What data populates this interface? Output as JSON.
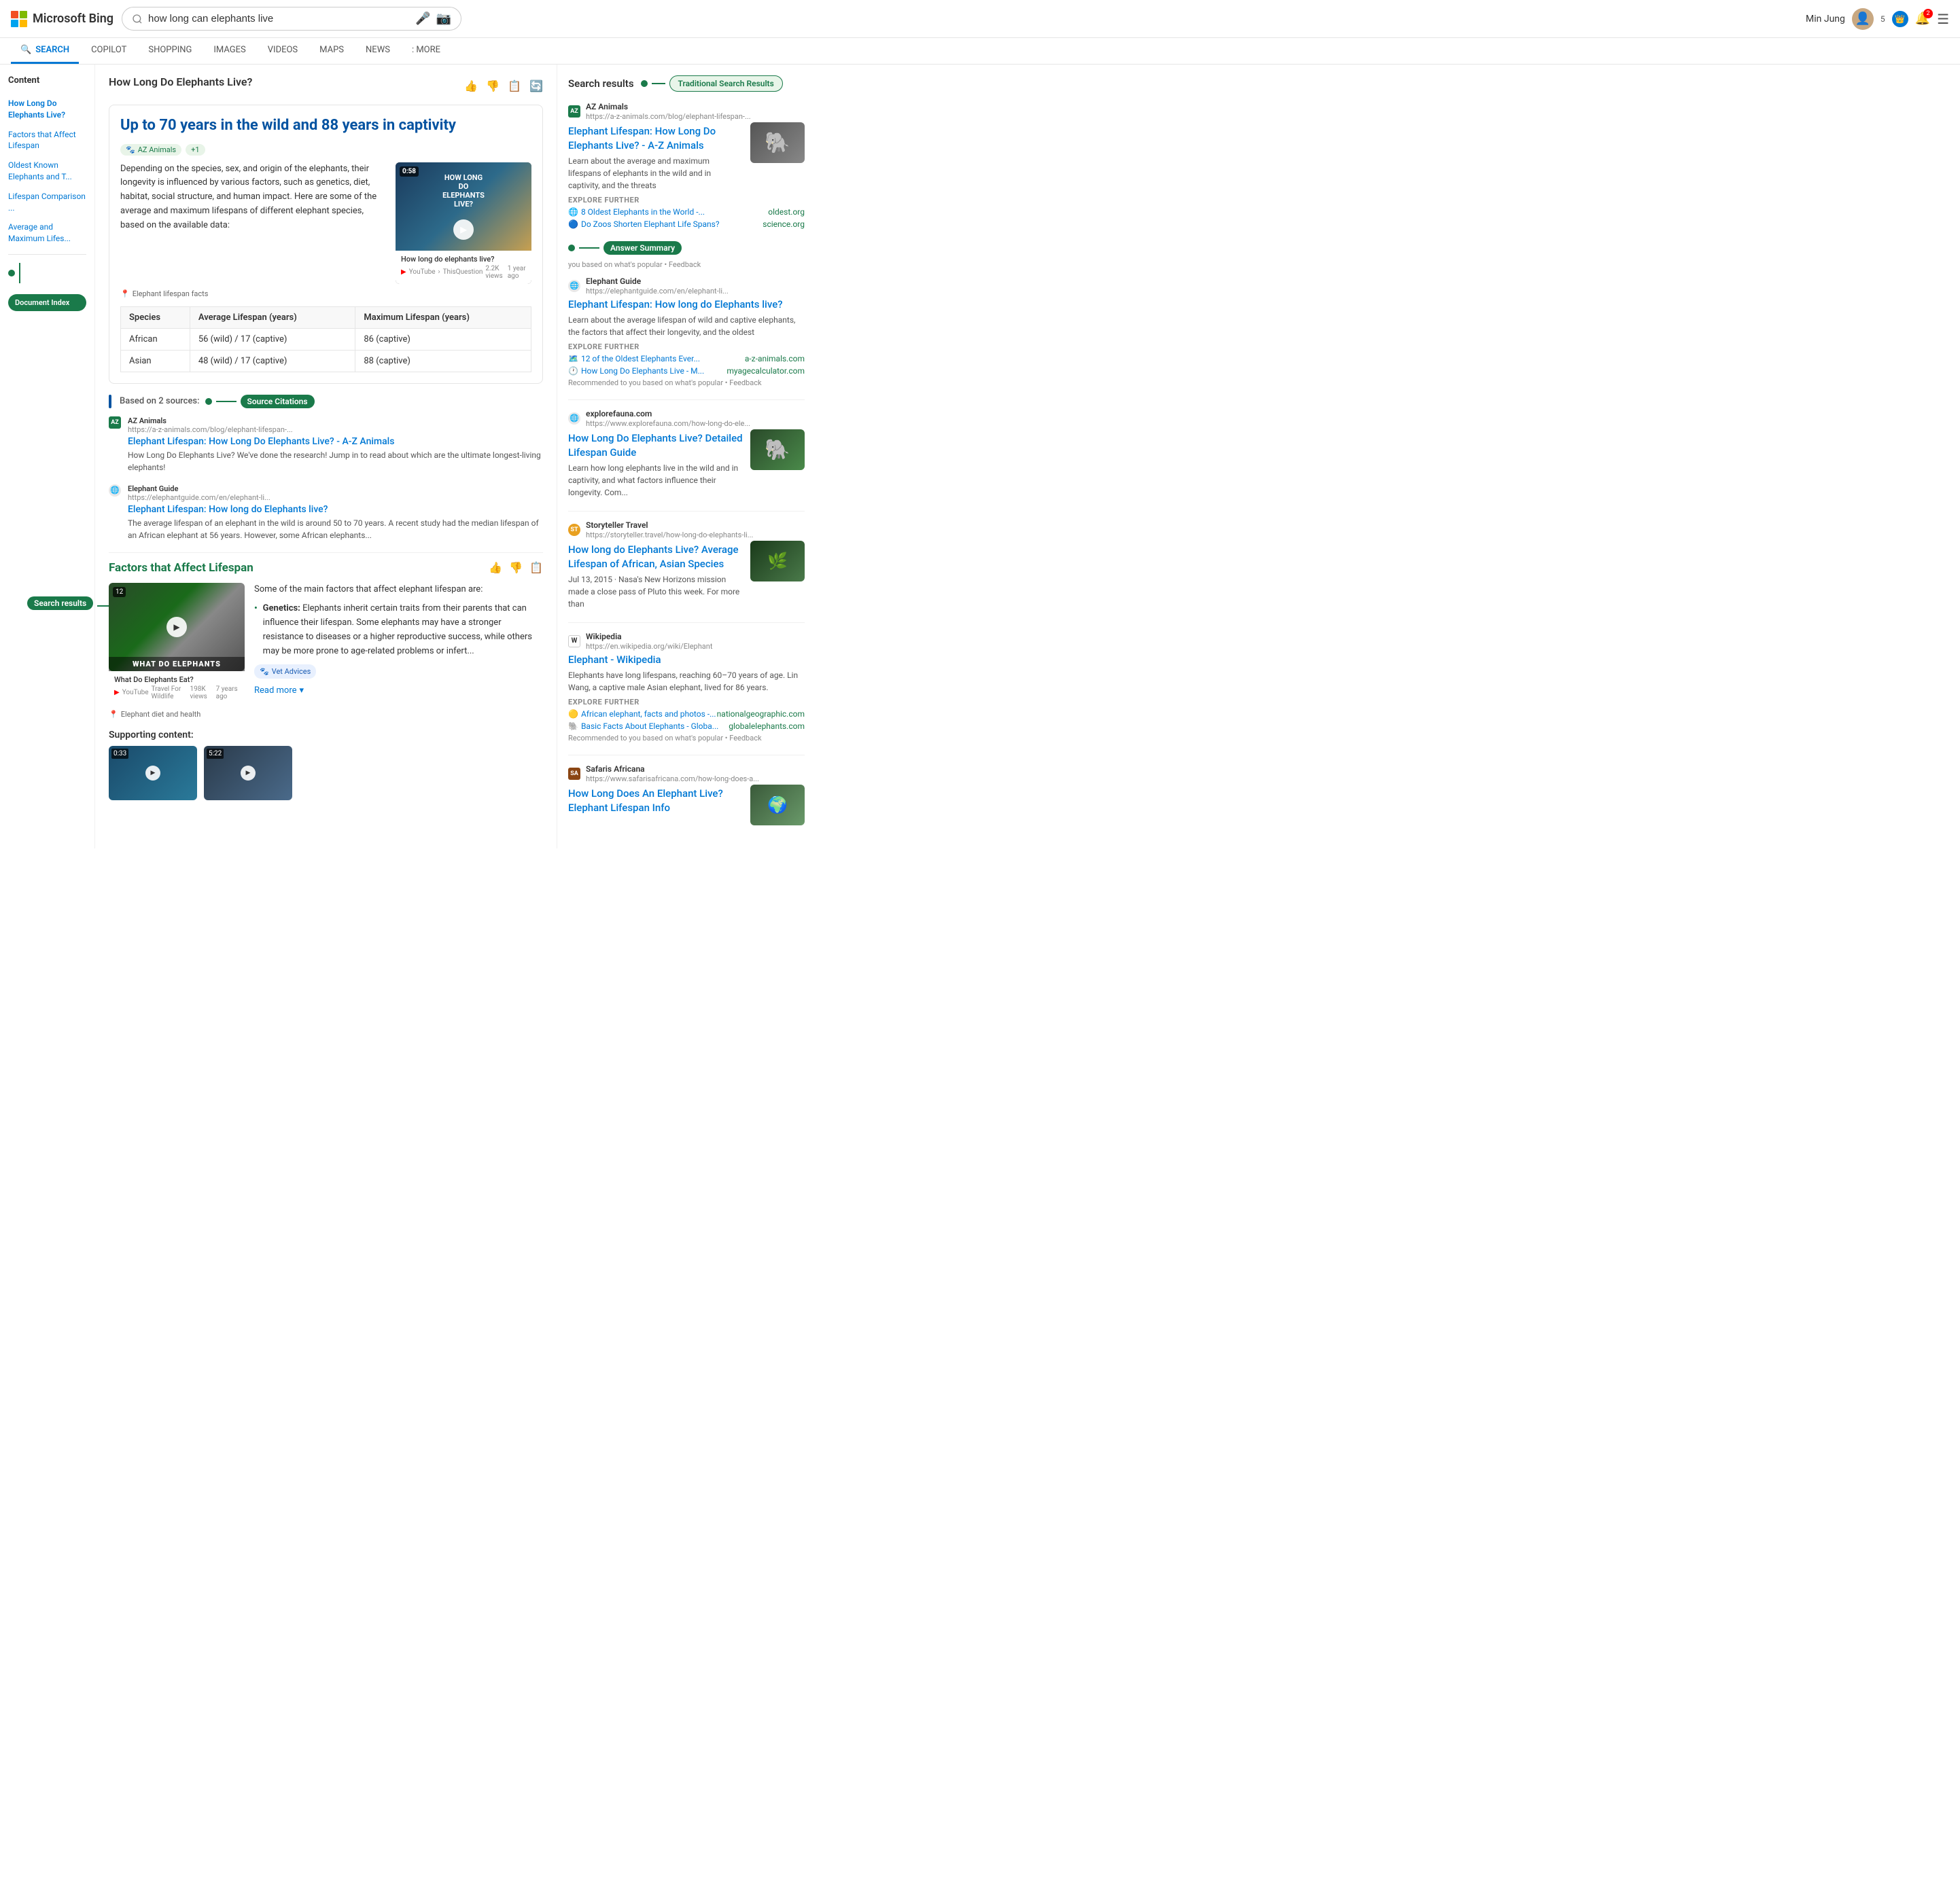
{
  "header": {
    "logo_text": "Microsoft Bing",
    "search_query": "how long can elephants live",
    "user_name": "Min Jung",
    "badge_count": "5",
    "notification_count": "2"
  },
  "nav": {
    "tabs": [
      {
        "id": "search",
        "label": "SEARCH",
        "active": true,
        "icon": "🔍"
      },
      {
        "id": "copilot",
        "label": "COPILOT",
        "active": false
      },
      {
        "id": "shopping",
        "label": "SHOPPING",
        "active": false
      },
      {
        "id": "images",
        "label": "IMAGES",
        "active": false
      },
      {
        "id": "videos",
        "label": "VIDEOS",
        "active": false
      },
      {
        "id": "maps",
        "label": "MAPS",
        "active": false
      },
      {
        "id": "news",
        "label": "NEWS",
        "active": false
      },
      {
        "id": "more",
        "label": ": MORE",
        "active": false
      }
    ]
  },
  "sidebar": {
    "title": "Content",
    "items": [
      {
        "label": "How Long Do Elephants Live?",
        "active": true
      },
      {
        "label": "Factors that Affect Lifespan"
      },
      {
        "label": "Oldest Known Elephants and T..."
      },
      {
        "label": "Lifespan Comparison ..."
      },
      {
        "label": "Average and Maximum Lifes..."
      }
    ],
    "doc_index_label": "Document Index"
  },
  "main": {
    "page_title": "How Long Do Elephants Live?",
    "answer_headline": "Up to 70 years in the wild and 88 years in captivity",
    "source_tags": [
      "AZ Animals",
      "+1"
    ],
    "answer_text": "Depending on the species, sex, and origin of the elephants, their longevity is influenced by various factors, such as genetics, diet, habitat, social structure, and human impact. Here are some of the average and maximum lifespans of different elephant species, based on the available data:",
    "elephant_fact_label": "Elephant lifespan facts",
    "video": {
      "timer": "0:58",
      "title": "How long do elephants live?",
      "source": "YouTube",
      "channel": "ThisQuestion",
      "views": "2.2K views",
      "time_ago": "1 year ago",
      "overlay_text": "HOW LONG\nDO\nELEPHANTS\nLIVE?"
    },
    "table": {
      "headers": [
        "Species",
        "Average Lifespan (years)",
        "Maximum Lifespan (years)"
      ],
      "rows": [
        [
          "African",
          "56 (wild) / 17 (captive)",
          "86 (captive)"
        ],
        [
          "Asian",
          "48 (wild) / 17 (captive)",
          "88 (captive)"
        ]
      ]
    },
    "sources_label": "Based on 2 sources:",
    "sources_badge": "Source Citations",
    "source_items": [
      {
        "site": "AZ Animals",
        "url": "https://a-z-animals.com/blog/elephant-lifespan-...",
        "title": "Elephant Lifespan: How Long Do Elephants Live? - A-Z Animals",
        "desc": "How Long Do Elephants Live? We've done the research! Jump in to read about which are the ultimate longest-living elephants!"
      },
      {
        "site": "Elephant Guide",
        "url": "https://elephantguide.com/en/elephant-li...",
        "title": "Elephant Lifespan: How long do Elephants live?",
        "desc": "The average lifespan of an elephant in the wild is around 50 to 70 years. A recent study had the median lifespan of an African elephant at 56 years. However, some African elephants..."
      }
    ],
    "factors_section": {
      "title": "Factors that Affect Lifespan",
      "video": {
        "timer": "12",
        "title": "What Do Elephants Eat?",
        "source": "YouTube",
        "channel": "Travel For Wildlife",
        "views": "198K views",
        "time_ago": "7 years ago",
        "overlay_text": "WHAT\nDO\nELEPHANTS"
      },
      "intro": "Some of the main factors that affect elephant lifespan are:",
      "bullets": [
        {
          "term": "Genetics",
          "text": "Elephants inherit certain traits from their parents that can influence their lifespan. Some elephants may have a stronger resistance to diseases or a higher reproductive success, while others may be more prone to age-related problems or infert..."
        }
      ],
      "vet_tag": "Vet Advices",
      "read_more": "Read more",
      "video_caption": "Elephant diet and health",
      "supporting_title": "Supporting content:"
    }
  },
  "right_sidebar": {
    "search_results_label": "Search results",
    "tsr_badge": "Traditional Search Results",
    "answer_summary_badge": "Answer Summary",
    "results": [
      {
        "site": "AZ Animals",
        "url": "https://a-z-animals.com/blog/elephant-lifespan-...",
        "title": "Elephant Lifespan: How Long Do Elephants Live? - A-Z Animals",
        "desc": "Learn about the average and maximum lifespans of elephants in the wild and in captivity, and the threats",
        "has_image": true,
        "explore_further": [
          {
            "text": "8 Oldest Elephants in the World -...",
            "domain": "oldest.org",
            "icon": "🌐"
          },
          {
            "text": "Do Zoos Shorten Elephant Life Spans?",
            "domain": "science.org",
            "icon": "🔵"
          }
        ]
      },
      {
        "site": "Elephant Guide",
        "url": "https://elephantguide.com/en/elephant-li...",
        "title": "Elephant Lifespan: How long do Elephants live?",
        "desc": "Learn about the average lifespan of wild and captive elephants, the factors that affect their longevity, and the oldest",
        "has_image": false,
        "explore_further": [
          {
            "text": "12 of the Oldest Elephants Ever...",
            "domain": "a-z-animals.com",
            "icon": "🗺️"
          },
          {
            "text": "How Long Do Elephants Live - M...",
            "domain": "myagecalculator.com",
            "icon": "🕐"
          }
        ],
        "recommended": "Recommended to you based on what's popular • Feedback"
      },
      {
        "site": "explorefauna.com",
        "url": "https://www.explorefauna.com/how-long-do-ele...",
        "title": "How Long Do Elephants Live? Detailed Lifespan Guide",
        "desc": "Learn how long elephants live in the wild and in captivity, and what factors influence their longevity. Com...",
        "has_image": true
      },
      {
        "site": "Storyteller Travel",
        "url": "https://storyteller.travel/how-long-do-elephants-li...",
        "title": "How long do Elephants Live? Average Lifespan of African, Asian Species",
        "desc": "Jul 13, 2015 · Nasa's New Horizons mission made a close pass of Pluto this week. For more than",
        "has_image": true
      },
      {
        "site": "Wikipedia",
        "url": "https://en.wikipedia.org/wiki/Elephant",
        "title": "Elephant - Wikipedia",
        "desc": "Elephants have long lifespans, reaching 60–70 years of age. Lin Wang, a captive male Asian elephant, lived for 86 years.",
        "has_image": false,
        "explore_further": [
          {
            "text": "African elephant, facts and photos -...",
            "domain": "nationalgeographic.com",
            "icon": "🟡"
          },
          {
            "text": "Basic Facts About Elephants - Globa...",
            "domain": "globalelephants.com",
            "icon": "🐘"
          }
        ],
        "recommended": "Recommended to you based on what's popular • Feedback"
      },
      {
        "site": "Safaris Africana",
        "url": "https://www.safarisafricana.com/how-long-does-a...",
        "title": "How Long Does An Elephant Live? Elephant Lifespan Info",
        "has_image": true
      }
    ]
  }
}
